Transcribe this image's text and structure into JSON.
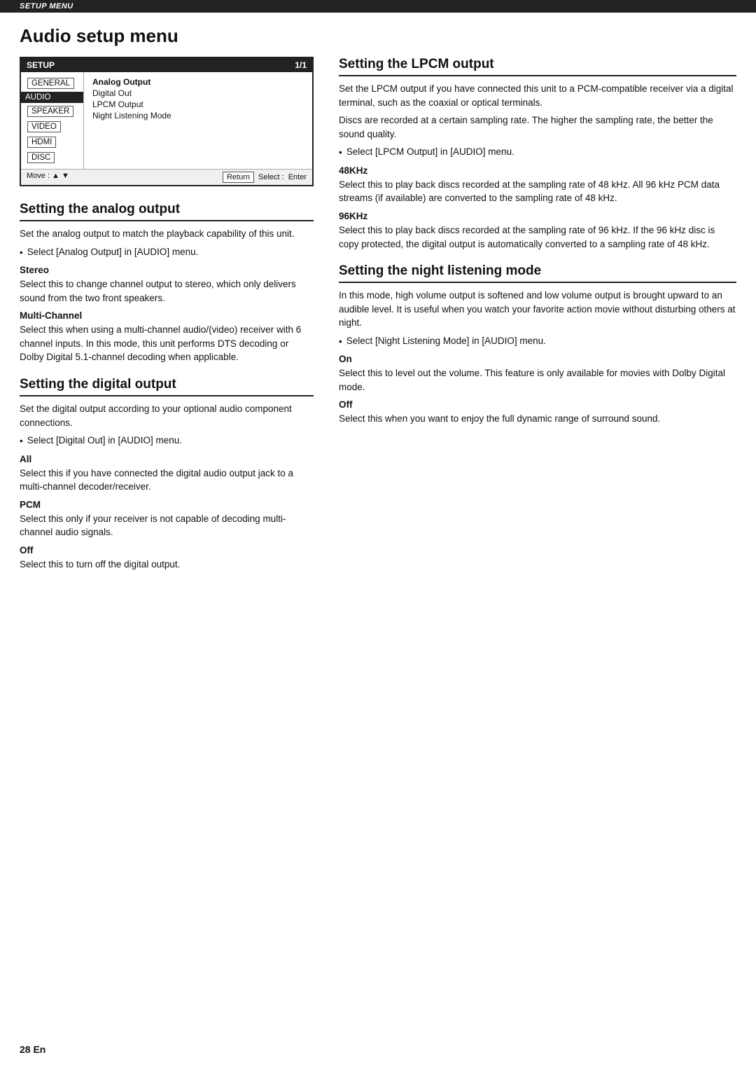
{
  "topBar": {
    "label": "SETUP MENU"
  },
  "pageTitle": "Audio setup menu",
  "menuBox": {
    "header": {
      "label": "SETUP",
      "page": "1/1"
    },
    "items": [
      {
        "label": "GENERAL",
        "boxed": true,
        "active": false
      },
      {
        "label": "AUDIO",
        "boxed": false,
        "active": true
      },
      {
        "label": "SPEAKER",
        "boxed": true,
        "active": false
      },
      {
        "label": "VIDEO",
        "boxed": true,
        "active": false
      },
      {
        "label": "HDMI",
        "boxed": true,
        "active": false
      },
      {
        "label": "DISC",
        "boxed": true,
        "active": false
      }
    ],
    "options": [
      {
        "label": "Analog Output",
        "highlighted": true
      },
      {
        "label": "Digital Out"
      },
      {
        "label": "LPCM Output"
      },
      {
        "label": "Night Listening Mode"
      }
    ],
    "footer": {
      "move_label": "Move : ▲ ▼",
      "return_label": "Return",
      "select_label": "Select :",
      "enter_label": "Enter"
    }
  },
  "sections": {
    "analogOutput": {
      "heading": "Setting the analog output",
      "intro": "Set the analog output to match the playback capability of this unit.",
      "bullet": "Select [Analog Output] in [AUDIO] menu.",
      "stereo": {
        "heading": "Stereo",
        "text": "Select this to change channel output to stereo, which only delivers sound from the two front speakers."
      },
      "multiChannel": {
        "heading": "Multi-Channel",
        "text": "Select this when using a multi-channel audio/(video) receiver with 6 channel inputs. In this mode, this unit performs DTS decoding or Dolby Digital 5.1-channel decoding when applicable."
      }
    },
    "digitalOutput": {
      "heading": "Setting the digital output",
      "intro": "Set the digital output according to your optional audio component connections.",
      "bullet": "Select [Digital Out] in [AUDIO] menu.",
      "all": {
        "heading": "All",
        "text": "Select this if you have connected the digital audio output jack to a multi-channel decoder/receiver."
      },
      "pcm": {
        "heading": "PCM",
        "text": "Select this only if your receiver is not capable of decoding multi-channel audio signals."
      },
      "off": {
        "heading": "Off",
        "text": "Select this to turn off the digital output."
      }
    },
    "lpcmOutput": {
      "heading": "Setting the LPCM output",
      "intro1": "Set the LPCM output if you have connected this unit to a PCM-compatible receiver via a digital terminal, such as the coaxial or optical terminals.",
      "intro2": "Discs are recorded at a certain sampling rate. The higher the sampling rate, the better the sound quality.",
      "bullet": "Select [LPCM Output] in [AUDIO] menu.",
      "khz48": {
        "heading": "48KHz",
        "text": "Select this to play back discs recorded at the sampling rate of 48 kHz. All 96 kHz PCM data streams (if available) are converted to the sampling rate of 48 kHz."
      },
      "khz96": {
        "heading": "96KHz",
        "text": "Select this to play back discs recorded at the sampling rate of 96 kHz. If the 96 kHz disc is copy protected, the digital output is automatically converted to a sampling rate of 48 kHz."
      }
    },
    "nightListening": {
      "heading": "Setting the night listening mode",
      "intro": "In this mode, high volume output is softened and low volume output is brought upward to an audible level. It is useful when you watch your favorite action movie without disturbing others at night.",
      "bullet": "Select [Night Listening Mode] in [AUDIO] menu.",
      "on": {
        "heading": "On",
        "text": "Select this to level out the volume. This feature is only available for movies with Dolby Digital mode."
      },
      "off": {
        "heading": "Off",
        "text": "Select this when you want to enjoy the full dynamic range of surround sound."
      }
    }
  },
  "footer": {
    "pageNumber": "28 En"
  }
}
